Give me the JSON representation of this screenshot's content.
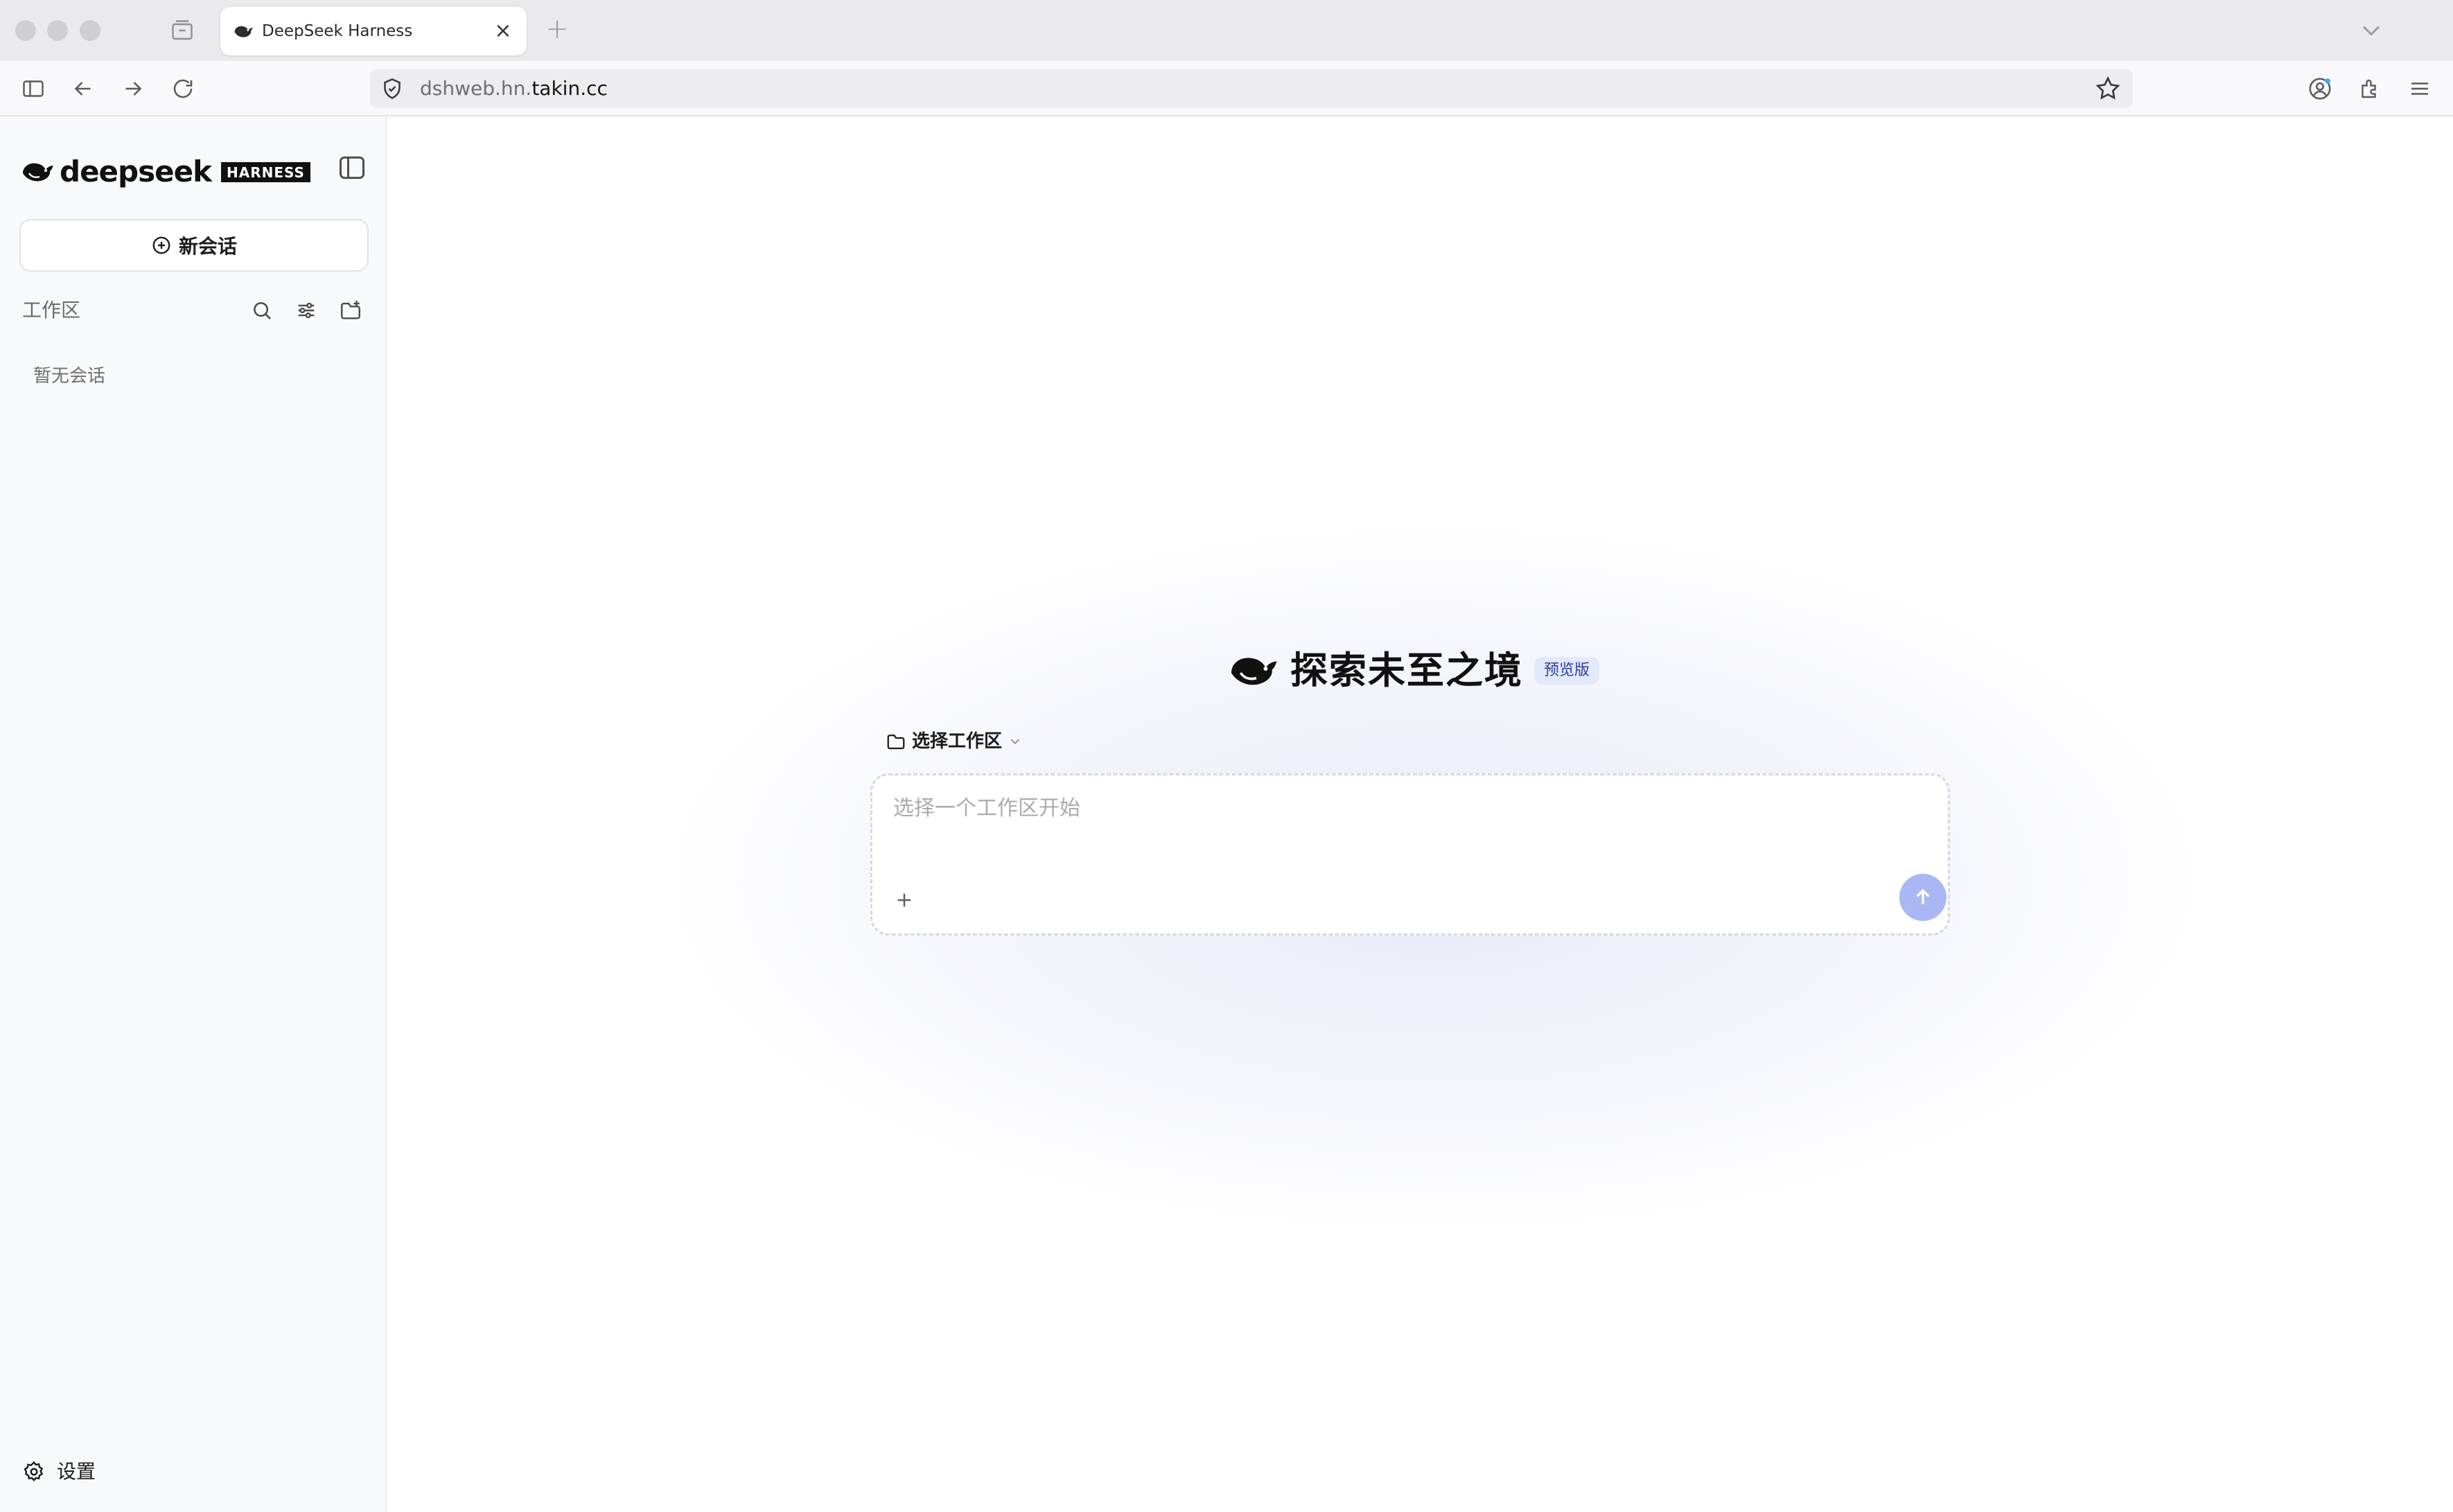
{
  "browser": {
    "tab_title": "DeepSeek Harness",
    "tab_close_glyph": "×",
    "new_tab_glyph": "+",
    "url_prefix": "dshweb.hn.",
    "url_host": "takin.cc"
  },
  "sidebar": {
    "brand_name": "deepseek",
    "brand_badge": "HARNESS",
    "new_chat_label": "新会话",
    "workspace_label": "工作区",
    "empty_label": "暂无会话",
    "settings_label": "设置"
  },
  "main": {
    "hero_title": "探索未至之境",
    "hero_badge": "预览版",
    "workspace_select_label": "选择工作区",
    "input_placeholder": "选择一个工作区开始"
  },
  "colors": {
    "accent_send": "#a9b7f4",
    "badge_bg": "#e3e8fb",
    "badge_text": "#2b3f9a"
  }
}
